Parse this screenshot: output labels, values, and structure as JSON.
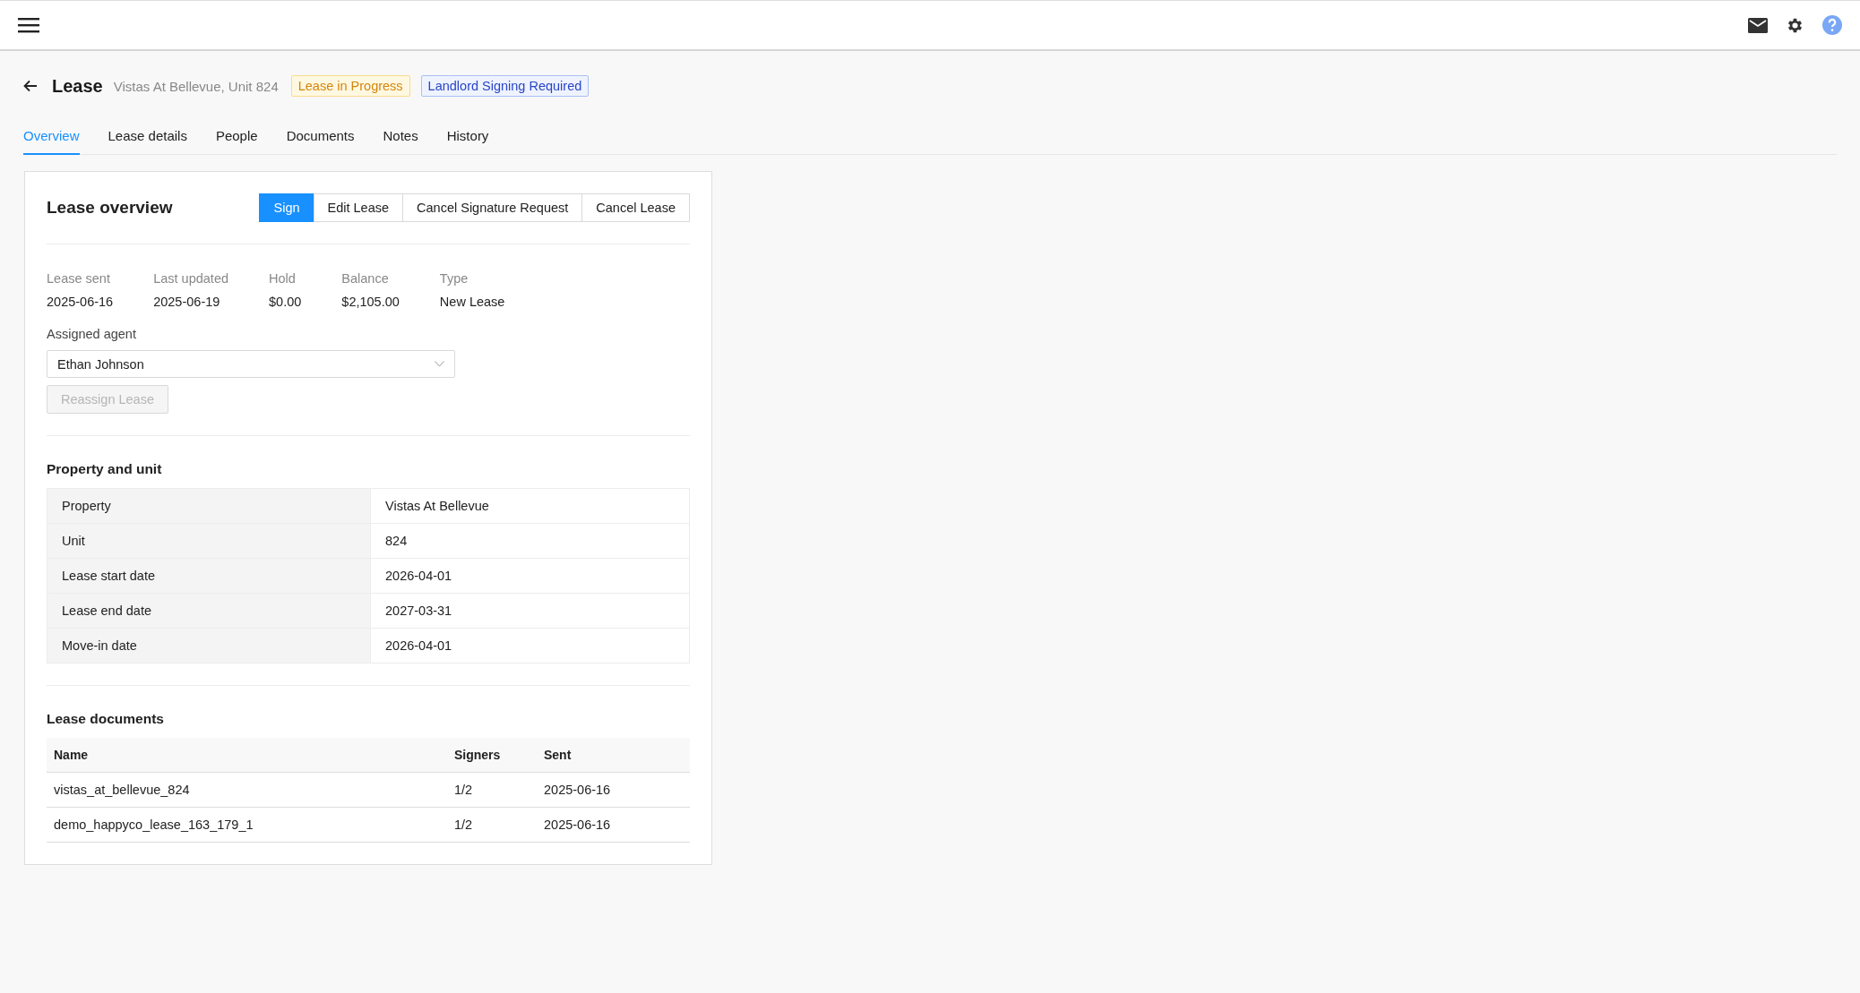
{
  "page": {
    "title": "Lease",
    "subtitle": "Vistas At Bellevue, Unit 824",
    "badges": [
      {
        "label": "Lease in Progress",
        "kind": "warning"
      },
      {
        "label": "Landlord Signing Required",
        "kind": "info"
      }
    ]
  },
  "tabs": [
    {
      "label": "Overview",
      "selected": true
    },
    {
      "label": "Lease details",
      "selected": false
    },
    {
      "label": "People",
      "selected": false
    },
    {
      "label": "Documents",
      "selected": false
    },
    {
      "label": "Notes",
      "selected": false
    },
    {
      "label": "History",
      "selected": false
    }
  ],
  "overview": {
    "title": "Lease overview",
    "actions": [
      {
        "label": "Sign",
        "kind": "primary"
      },
      {
        "label": "Edit Lease",
        "kind": "default"
      },
      {
        "label": "Cancel Signature Request",
        "kind": "default"
      },
      {
        "label": "Cancel Lease",
        "kind": "default"
      }
    ],
    "facts": [
      {
        "label": "Lease sent",
        "value": "2025-06-16"
      },
      {
        "label": "Last updated",
        "value": "2025-06-19"
      },
      {
        "label": "Hold",
        "value": "$0.00"
      },
      {
        "label": "Balance",
        "value": "$2,105.00"
      },
      {
        "label": "Type",
        "value": "New Lease"
      }
    ],
    "assigned_agent": {
      "label": "Assigned agent",
      "value": "Ethan Johnson"
    },
    "reassign_button": {
      "label": "Reassign Lease",
      "disabled": true
    }
  },
  "property_and_unit": {
    "title": "Property and unit",
    "rows": [
      {
        "label": "Property",
        "value": "Vistas At Bellevue"
      },
      {
        "label": "Unit",
        "value": "824"
      },
      {
        "label": "Lease start date",
        "value": "2026-04-01"
      },
      {
        "label": "Lease end date",
        "value": "2027-03-31"
      },
      {
        "label": "Move-in date",
        "value": "2026-04-01"
      }
    ]
  },
  "lease_documents": {
    "title": "Lease documents",
    "columns": [
      "Name",
      "Signers",
      "Sent"
    ],
    "rows": [
      [
        "vistas_at_bellevue_824",
        "1/2",
        "2025-06-16"
      ],
      [
        "demo_happyco_lease_163_179_1",
        "1/2",
        "2025-06-16"
      ]
    ]
  }
}
